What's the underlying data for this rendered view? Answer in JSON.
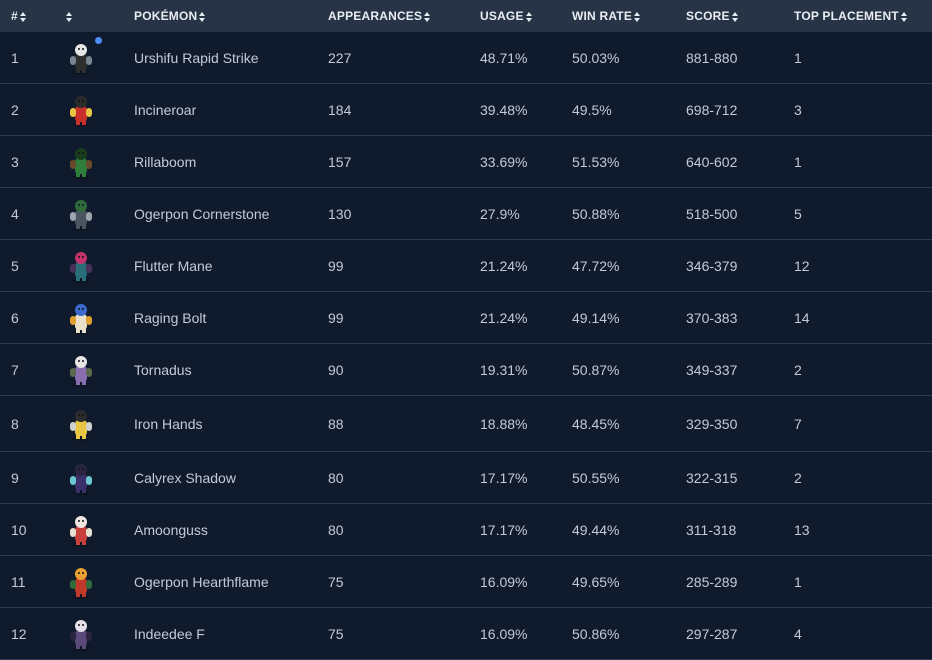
{
  "columns": {
    "rank": "#",
    "sprite": "",
    "pokemon": "POKÉMON",
    "appearances": "APPEARANCES",
    "usage": "USAGE",
    "win_rate": "WIN RATE",
    "score": "SCORE",
    "top_placement": "TOP PLACEMENT"
  },
  "rows": [
    {
      "rank": "1",
      "name": "Urshifu Rapid Strike",
      "appearances": "227",
      "usage": "48.71%",
      "win_rate": "50.03%",
      "score": "881-880",
      "top": "1",
      "icon": "urshifu-rapid-strike-sprite-icon",
      "colors": [
        "#2e2e2e",
        "#e6e6e6",
        "#7a8592"
      ],
      "badge": true
    },
    {
      "rank": "2",
      "name": "Incineroar",
      "appearances": "184",
      "usage": "39.48%",
      "win_rate": "49.5%",
      "score": "698-712",
      "top": "3",
      "icon": "incineroar-sprite-icon",
      "colors": [
        "#c9302c",
        "#2b2b2b",
        "#e8c542"
      ]
    },
    {
      "rank": "3",
      "name": "Rillaboom",
      "appearances": "157",
      "usage": "33.69%",
      "win_rate": "51.53%",
      "score": "640-602",
      "top": "1",
      "icon": "rillaboom-sprite-icon",
      "colors": [
        "#2f7d3a",
        "#1a3d1f",
        "#6a4a2c"
      ]
    },
    {
      "rank": "4",
      "name": "Ogerpon Cornerstone",
      "appearances": "130",
      "usage": "27.9%",
      "win_rate": "50.88%",
      "score": "518-500",
      "top": "5",
      "icon": "ogerpon-cornerstone-sprite-icon",
      "colors": [
        "#4a5560",
        "#2f6b3b",
        "#9aa5ad"
      ]
    },
    {
      "rank": "5",
      "name": "Flutter Mane",
      "appearances": "99",
      "usage": "21.24%",
      "win_rate": "47.72%",
      "score": "346-379",
      "top": "12",
      "icon": "flutter-mane-sprite-icon",
      "colors": [
        "#2a6e7a",
        "#c2336b",
        "#4a2f5a"
      ]
    },
    {
      "rank": "6",
      "name": "Raging Bolt",
      "appearances": "99",
      "usage": "21.24%",
      "win_rate": "49.14%",
      "score": "370-383",
      "top": "14",
      "icon": "raging-bolt-sprite-icon",
      "colors": [
        "#e8e0c8",
        "#3a6ad0",
        "#e0a030"
      ]
    },
    {
      "rank": "7",
      "name": "Tornadus",
      "appearances": "90",
      "usage": "19.31%",
      "win_rate": "50.87%",
      "score": "349-337",
      "top": "2",
      "icon": "tornadus-sprite-icon",
      "colors": [
        "#8a6fb0",
        "#e6e6e6",
        "#5a6a4a"
      ]
    },
    {
      "rank": "8",
      "name": "Iron Hands",
      "appearances": "88",
      "usage": "18.88%",
      "win_rate": "48.45%",
      "score": "329-350",
      "top": "7",
      "icon": "iron-hands-sprite-icon",
      "colors": [
        "#e8c542",
        "#2b2b2b",
        "#d0d0d0"
      ]
    },
    {
      "rank": "9",
      "name": "Calyrex Shadow",
      "appearances": "80",
      "usage": "17.17%",
      "win_rate": "50.55%",
      "score": "322-315",
      "top": "2",
      "icon": "calyrex-shadow-sprite-icon",
      "colors": [
        "#3a2f6a",
        "#2a2440",
        "#6ac8d0"
      ]
    },
    {
      "rank": "10",
      "name": "Amoonguss",
      "appearances": "80",
      "usage": "17.17%",
      "win_rate": "49.44%",
      "score": "311-318",
      "top": "13",
      "icon": "amoonguss-sprite-icon",
      "colors": [
        "#c8403a",
        "#f0e8e0",
        "#e8e0d0"
      ]
    },
    {
      "rank": "11",
      "name": "Ogerpon Hearthflame",
      "appearances": "75",
      "usage": "16.09%",
      "win_rate": "49.65%",
      "score": "285-289",
      "top": "1",
      "icon": "ogerpon-hearthflame-sprite-icon",
      "colors": [
        "#c0392b",
        "#e8a030",
        "#2f6b3b"
      ]
    },
    {
      "rank": "12",
      "name": "Indeedee F",
      "appearances": "75",
      "usage": "16.09%",
      "win_rate": "50.86%",
      "score": "297-287",
      "top": "4",
      "icon": "indeedee-f-sprite-icon",
      "colors": [
        "#5a4a7a",
        "#e6e0ea",
        "#2a2440"
      ]
    }
  ]
}
